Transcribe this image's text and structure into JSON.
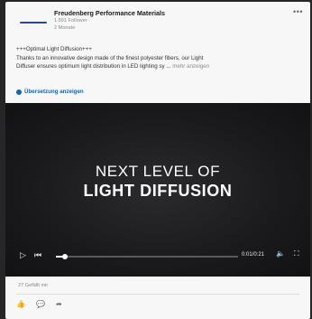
{
  "post": {
    "company": "Freudenberg Performance Materials",
    "followers": "1.591 Follower",
    "time": "2 Monate",
    "menu_icon": "more-horizontal-icon",
    "text_line1": "+++Optimal Light Diffusion+++",
    "text_line2": "Thanks to an innovative design made of the finest polyester fibers, our Light",
    "text_line3": "Diffuser ensures optimum light distribution in LED lighting sy ...",
    "see_more": "mehr anzeigen",
    "translate": "Übersetzung anzeigen"
  },
  "video": {
    "title_line1": "NEXT LEVEL OF",
    "title_line2": "LIGHT DIFFUSION",
    "timecode": "0:01/0:21",
    "progress": 0.05,
    "controls": [
      "play-icon",
      "skip-back-icon",
      "volume-icon",
      "fullscreen-icon"
    ]
  },
  "footer": {
    "likes": "27 Gefällt mir",
    "actions": [
      "like-icon",
      "comment-icon",
      "share-icon"
    ]
  }
}
